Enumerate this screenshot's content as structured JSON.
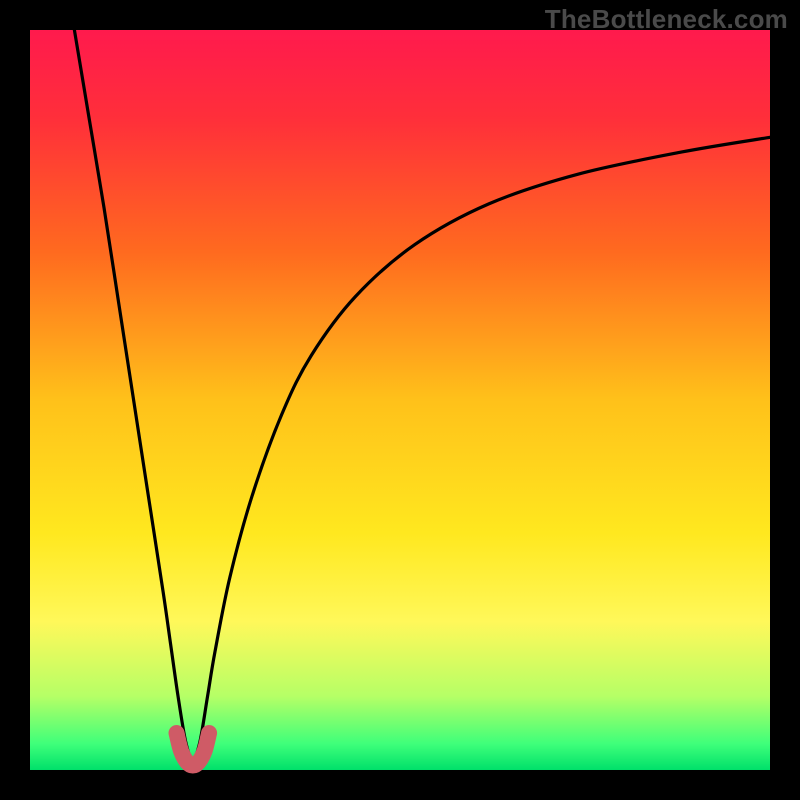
{
  "watermark": "TheBottleneck.com",
  "colors": {
    "frame": "#000000",
    "gradient_stops": [
      {
        "offset": 0.0,
        "color": "#ff1a4d"
      },
      {
        "offset": 0.12,
        "color": "#ff2f3a"
      },
      {
        "offset": 0.3,
        "color": "#ff6a1f"
      },
      {
        "offset": 0.5,
        "color": "#ffc11a"
      },
      {
        "offset": 0.68,
        "color": "#ffe81f"
      },
      {
        "offset": 0.8,
        "color": "#fff85a"
      },
      {
        "offset": 0.9,
        "color": "#b6ff66"
      },
      {
        "offset": 0.965,
        "color": "#3eff7a"
      },
      {
        "offset": 1.0,
        "color": "#00e06a"
      }
    ],
    "curve": "#000000",
    "highlight": "#cf5b66"
  },
  "chart_data": {
    "type": "line",
    "title": "",
    "xlabel": "",
    "ylabel": "",
    "xlim": [
      0,
      100
    ],
    "ylim": [
      0,
      100
    ],
    "x_at_min": 22,
    "series": [
      {
        "name": "left-branch",
        "x": [
          6,
          8,
          10,
          12,
          14,
          16,
          18,
          19,
          20,
          21,
          22
        ],
        "y": [
          100,
          88,
          76,
          63,
          50,
          37,
          24,
          17,
          10,
          4,
          0.5
        ]
      },
      {
        "name": "right-branch",
        "x": [
          22,
          23,
          24,
          25,
          27,
          30,
          34,
          38,
          44,
          52,
          62,
          74,
          88,
          100
        ],
        "y": [
          0.5,
          4,
          10,
          16,
          26,
          37,
          48,
          56,
          64,
          71,
          76.5,
          80.5,
          83.5,
          85.5
        ]
      }
    ],
    "highlight_segment": {
      "name": "bottom-u",
      "x": [
        19.8,
        20.4,
        21.2,
        22.0,
        22.8,
        23.6,
        24.2
      ],
      "y": [
        5.0,
        2.6,
        1.1,
        0.6,
        1.1,
        2.6,
        5.0
      ]
    }
  }
}
